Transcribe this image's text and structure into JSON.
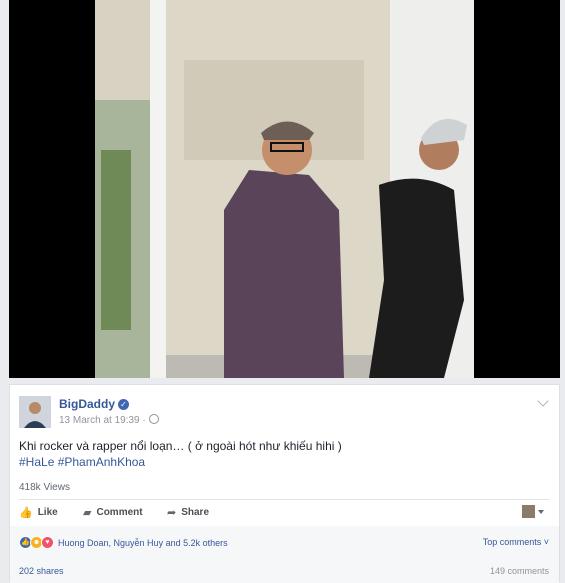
{
  "post": {
    "author": "BigDaddy",
    "timestamp": "13 March at 19:39 ·",
    "text": "Khi rocker và rapper nổi loạn… ( ở ngoài hót như khiếu hihi )",
    "hashtags": "#HaLe #PhamAnhKhoa",
    "views": "418k Views"
  },
  "actions": {
    "like_label": "Like",
    "comment_label": "Comment",
    "share_label": "Share"
  },
  "reactions": {
    "summary": "Huong Doan, Nguyễn Huy and 5.2k others",
    "sort_label": "Top comments ˅"
  },
  "footer": {
    "shares": "202 shares",
    "comments": "149 comments"
  },
  "colors": {
    "link": "#365899",
    "like_blue": "#4267b2",
    "haha_yellow": "#f7b125",
    "love_red": "#f25268"
  },
  "icons": [
    "play-video",
    "verified-badge-icon",
    "globe-icon",
    "chevron-down-icon",
    "like-icon",
    "comment-icon",
    "share-icon",
    "viewer-avatar-icon"
  ]
}
